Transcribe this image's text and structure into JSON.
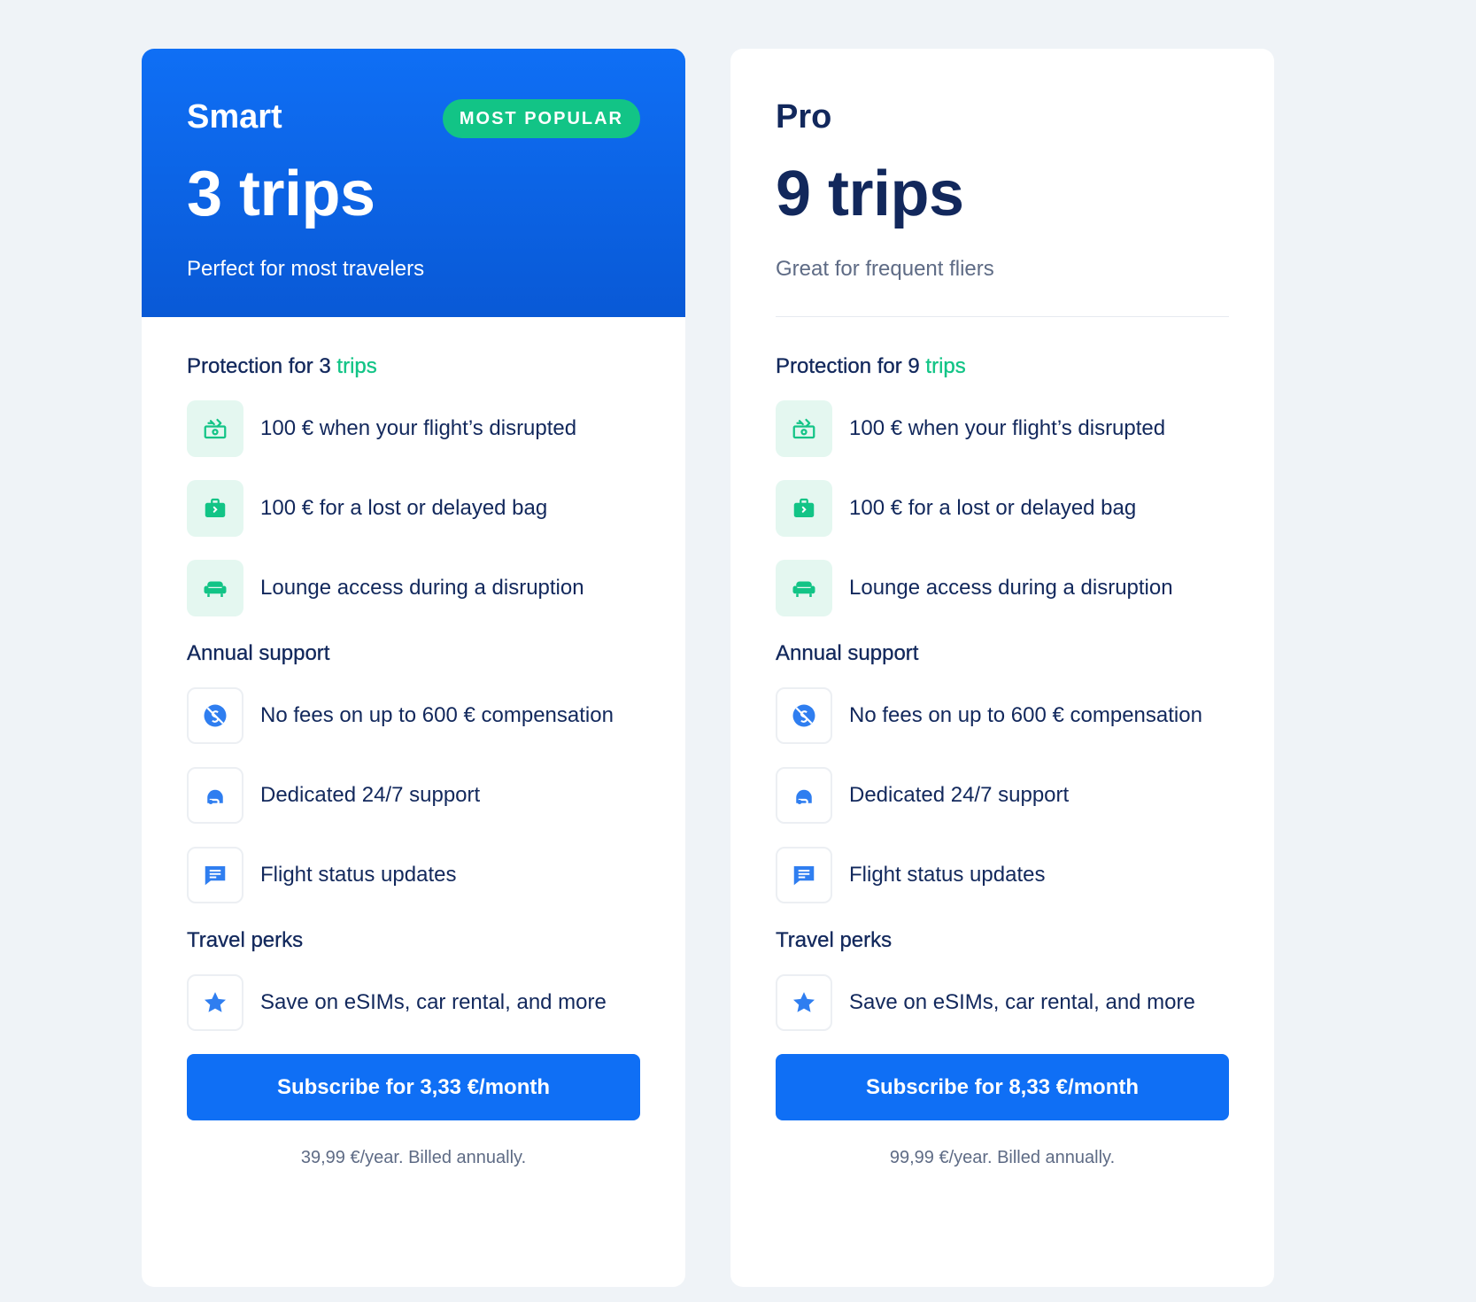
{
  "plans": [
    {
      "name": "Smart",
      "badge": "MOST POPULAR",
      "trips": "3 trips",
      "tagline": "Perfect for most travelers",
      "protection_title": "Protection for 3",
      "protection_accent": "trips",
      "protection_features": [
        {
          "icon": "cash-icon",
          "text": "100 € when your flight’s disrupted"
        },
        {
          "icon": "suitcase-icon",
          "text": "100 € for a lost or delayed bag"
        },
        {
          "icon": "lounge-chair-icon",
          "text": "Lounge access during a disruption"
        }
      ],
      "support_title": "Annual support",
      "support_features": [
        {
          "icon": "no-fees-icon",
          "text": "No fees on up to 600 € compensation"
        },
        {
          "icon": "headset-icon",
          "text": "Dedicated 24/7 support"
        },
        {
          "icon": "message-icon",
          "text": "Flight status updates"
        }
      ],
      "perks_title": "Travel perks",
      "perks_features": [
        {
          "icon": "star-icon",
          "text": "Save on eSIMs, car rental, and more"
        }
      ],
      "cta": "Subscribe for 3,33 €/month",
      "billing": "39,99 €/year. Billed annually."
    },
    {
      "name": "Pro",
      "trips": "9 trips",
      "tagline": "Great for frequent fliers",
      "protection_title": "Protection for 9",
      "protection_accent": "trips",
      "protection_features": [
        {
          "icon": "cash-icon",
          "text": "100 € when your flight’s disrupted"
        },
        {
          "icon": "suitcase-icon",
          "text": "100 € for a lost or delayed bag"
        },
        {
          "icon": "lounge-chair-icon",
          "text": "Lounge access during a disruption"
        }
      ],
      "support_title": "Annual support",
      "support_features": [
        {
          "icon": "no-fees-icon",
          "text": "No fees on up to 600 € compensation"
        },
        {
          "icon": "headset-icon",
          "text": "Dedicated 24/7 support"
        },
        {
          "icon": "message-icon",
          "text": "Flight status updates"
        }
      ],
      "perks_title": "Travel perks",
      "perks_features": [
        {
          "icon": "star-icon",
          "text": "Save on eSIMs, car rental, and more"
        }
      ],
      "cta": "Subscribe for 8,33 €/month",
      "billing": "99,99 €/year. Billed annually."
    }
  ],
  "colors": {
    "brand_blue": "#0f6ff5",
    "accent_green": "#12c486",
    "navy_text": "#12285c",
    "muted_text": "#5e6b85",
    "page_background": "#eff3f7"
  }
}
